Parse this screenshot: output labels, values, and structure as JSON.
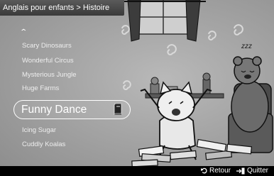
{
  "header": {
    "breadcrumb": "Anglais pour enfants > Histoire"
  },
  "menu": {
    "items": [
      {
        "label": "Scary Dinosaurs"
      },
      {
        "label": "Wonderful Circus"
      },
      {
        "label": "Mysterious Jungle"
      },
      {
        "label": "Huge Farms"
      },
      {
        "label": "Funny Dance"
      },
      {
        "label": "Icing Sugar"
      },
      {
        "label": "Cuddly Koalas"
      }
    ],
    "selected_index": 4
  },
  "illustration": {
    "sleep_text": "zzz"
  },
  "footer": {
    "back_label": "Retour",
    "exit_label": "Quitter"
  }
}
